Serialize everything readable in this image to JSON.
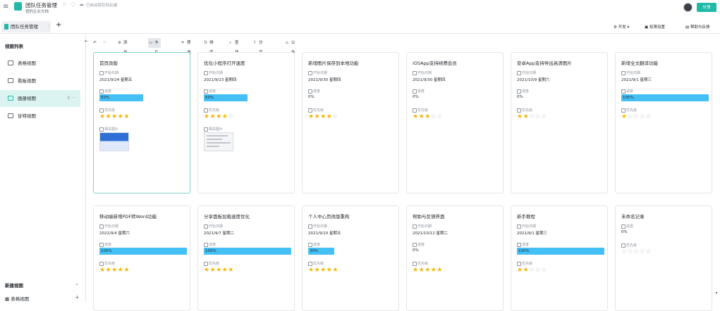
{
  "top": {
    "title": "团队任务管理",
    "saved_text": "已自动保存到云端",
    "workspace": "我的企业文档",
    "share_label": "分享",
    "menu_glyph": "≡",
    "star_glyph": "☆",
    "info_glyph": "◌"
  },
  "tabs": {
    "active_label": "团队任务管理",
    "more_glyph": "⋮",
    "add_glyph": "+"
  },
  "header_tools": {
    "dev_label": "开发",
    "perm_label": "权限设置",
    "help_label": "帮助与反馈"
  },
  "sidebar": {
    "title": "视图列表",
    "items": [
      {
        "label": "表格视图",
        "icon": "table-icon"
      },
      {
        "label": "看板视图",
        "icon": "kanban-icon"
      },
      {
        "label": "画册视图",
        "icon": "gallery-icon",
        "active": true
      },
      {
        "label": "甘特视图",
        "icon": "gantt-icon"
      }
    ],
    "new_view_label": "新建视图",
    "footer_item_label": "表格视图",
    "plus_glyph": "+",
    "chevron_glyph": "⌄",
    "pin_glyph": "⚲",
    "more_glyph": "···"
  },
  "toolbar": {
    "items": [
      "添加记录",
      "卡片管理",
      "筛选",
      "排序",
      "查找",
      "分享视图",
      "公告"
    ],
    "active_index": 1,
    "undo_glyph": "↶",
    "redo_glyph": "↷"
  },
  "field_labels": {
    "start": "开始日期",
    "progress": "进度",
    "priority": "优先级",
    "image": "相关图片"
  },
  "cards": [
    {
      "title": "首页改版",
      "date": "2021/9/24 星期五",
      "progress": "50%",
      "progress_value": 0.5,
      "rating": 5,
      "image": "thumb1"
    },
    {
      "title": "优化小程序打开速度",
      "date": "2021/9/23 星期四",
      "progress": "50%",
      "progress_value": 0.5,
      "rating": 4,
      "image": "thumb2"
    },
    {
      "title": "新增图片保存到本地功能",
      "date": "2021/9/30 星期四",
      "progress": "0%",
      "progress_value": 0,
      "rating": 4
    },
    {
      "title": "iOSApp支持续费会员",
      "date": "2021/9/30 星期四",
      "progress": "0%",
      "progress_value": 0,
      "rating": 3
    },
    {
      "title": "安卓App支持导出高清图片",
      "date": "2021/10/9 星期六",
      "progress": "0%",
      "progress_value": 0,
      "rating": 2
    },
    {
      "title": "新增全文翻译功能",
      "date": "2021/9/1 星期三",
      "progress": "100%",
      "progress_value": 1,
      "rating": 1
    },
    {
      "title": "移动端新增PDF转Word功能",
      "date": "2021/9/4 星期六",
      "progress": "100%",
      "progress_value": 1,
      "rating": 5
    },
    {
      "title": "分享面板加载速度优化",
      "date": "2021/9/7 星期二",
      "progress": "100%",
      "progress_value": 1,
      "rating": 5
    },
    {
      "title": "个人中心页改版重构",
      "date": "2021/9/10 星期五",
      "progress": "30%",
      "progress_value": 0.3,
      "rating": 5
    },
    {
      "title": "帮助与反馈界面",
      "date": "2021/10/12 星期二",
      "progress": "0%",
      "progress_value": 0,
      "rating": 5
    },
    {
      "title": "新手教程",
      "date": "2021/9/1 星期三",
      "progress": "100%",
      "progress_value": 1,
      "rating": 2
    },
    {
      "title": "未命名记录",
      "date": null,
      "progress": "0%",
      "progress_value": 0,
      "rating": 0
    }
  ],
  "colors": {
    "accent": "#1fb9a6",
    "progress": "#45c0f5",
    "star": "#f7b500"
  }
}
